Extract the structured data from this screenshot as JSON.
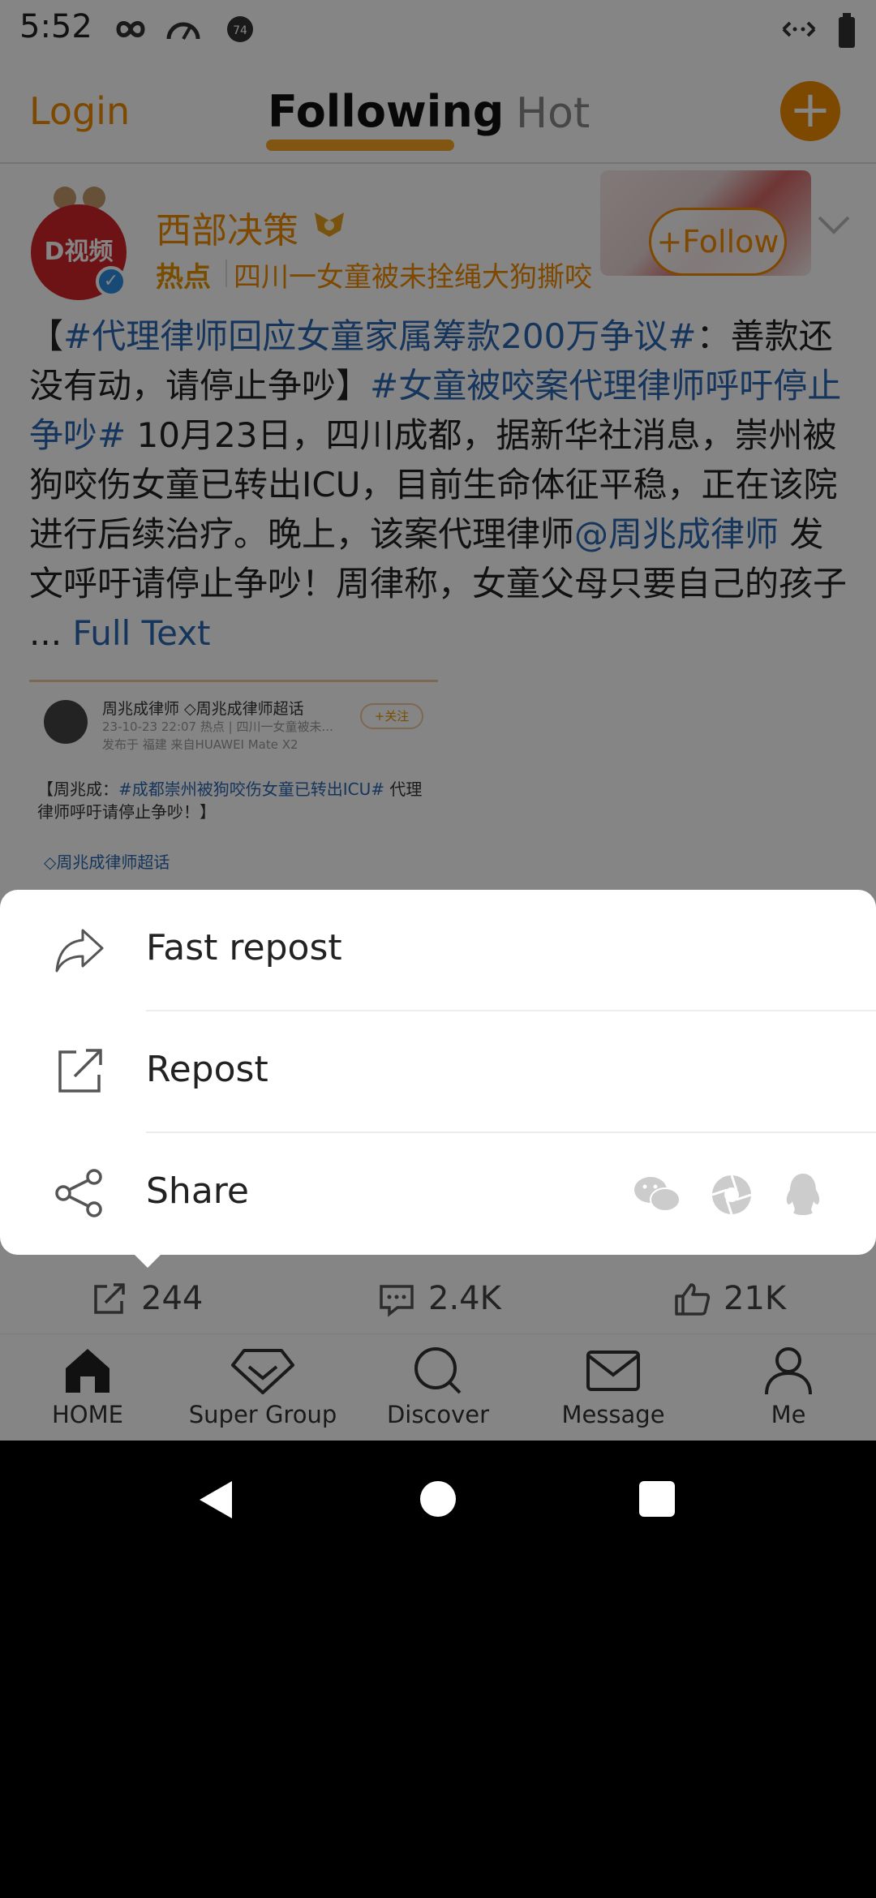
{
  "status_bar": {
    "time": "5:52"
  },
  "top_nav": {
    "login": "Login",
    "tab_following": "Following",
    "tab_hot": "Hot",
    "add": "+"
  },
  "post": {
    "avatar_text": "D视频",
    "author": "西部决策",
    "hot_label": "热点",
    "hot_title": "四川一女童被未拴绳大狗撕咬",
    "follow": "+Follow",
    "text": {
      "open": "【",
      "tag1": "#代理律师回应女童家属筹款200万争议#",
      "t1": "：善款还没有动，请停止争吵】",
      "tag2": "#女童被咬案代理律师呼吁停止争吵#",
      "t2": " 10月23日，四川成都，据新华社消息，崇州被狗咬伤女童已转出ICU，目前生命体征平稳，正在该院进行后续治疗。晚上，该案代理律师",
      "mention": "@周兆成律师",
      "t3": " 发文呼吁请停止争吵！周律称，女童父母只要自己的孩子 ... ",
      "full_text": "Full Text"
    },
    "embed": {
      "name": "周兆成律师 ◇周兆成律师超话",
      "meta1": "23-10-23 22:07  热点 | 四川一女童被未...",
      "meta2": "发布于 福建  来自HUAWEI Mate X2",
      "follow": "+关注",
      "text_a": "【周兆成：",
      "text_tag": "#成都崇州被狗咬伤女童已转出ICU#",
      "text_b": " 代理律师呼吁请停止争吵！】",
      "super": "◇周兆成律师超话"
    }
  },
  "sheet": {
    "fast_repost": "Fast repost",
    "repost": "Repost",
    "share": "Share",
    "share_apps": [
      "wechat-icon",
      "moments-icon",
      "qq-icon"
    ]
  },
  "actions": {
    "repost_count": "244",
    "comment_count": "2.4K",
    "like_count": "21K"
  },
  "bottom_nav": [
    {
      "label": "HOME"
    },
    {
      "label": "Super Group"
    },
    {
      "label": "Discover"
    },
    {
      "label": "Message"
    },
    {
      "label": "Me"
    }
  ],
  "colors": {
    "accent": "#f08a00",
    "link": "#2b66b1",
    "dim": "rgba(0,0,0,0.48)"
  }
}
